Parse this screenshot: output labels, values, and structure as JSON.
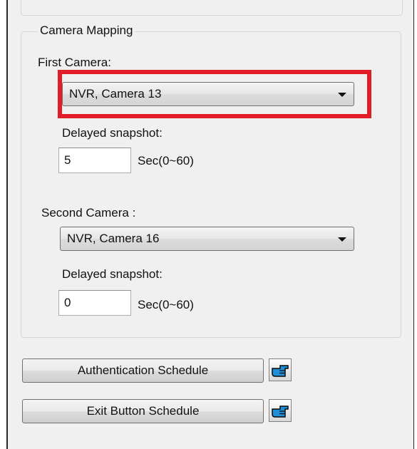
{
  "group": {
    "title": "Camera Mapping"
  },
  "first_camera": {
    "label": "First Camera:",
    "selected": "NVR, Camera 13",
    "delay_label": "Delayed snapshot:",
    "delay_value": "5",
    "unit": "Sec(0~60)"
  },
  "second_camera": {
    "label": "Second Camera :",
    "selected": "NVR, Camera 16",
    "delay_label": "Delayed snapshot:",
    "delay_value": "0",
    "unit": "Sec(0~60)"
  },
  "buttons": {
    "auth_schedule": "Authentication Schedule",
    "exit_schedule": "Exit Button Schedule"
  },
  "colors": {
    "highlight": "#e21d2a",
    "icon": "#1e8fd8"
  },
  "icons": {
    "action": "pointing-hand-icon"
  }
}
